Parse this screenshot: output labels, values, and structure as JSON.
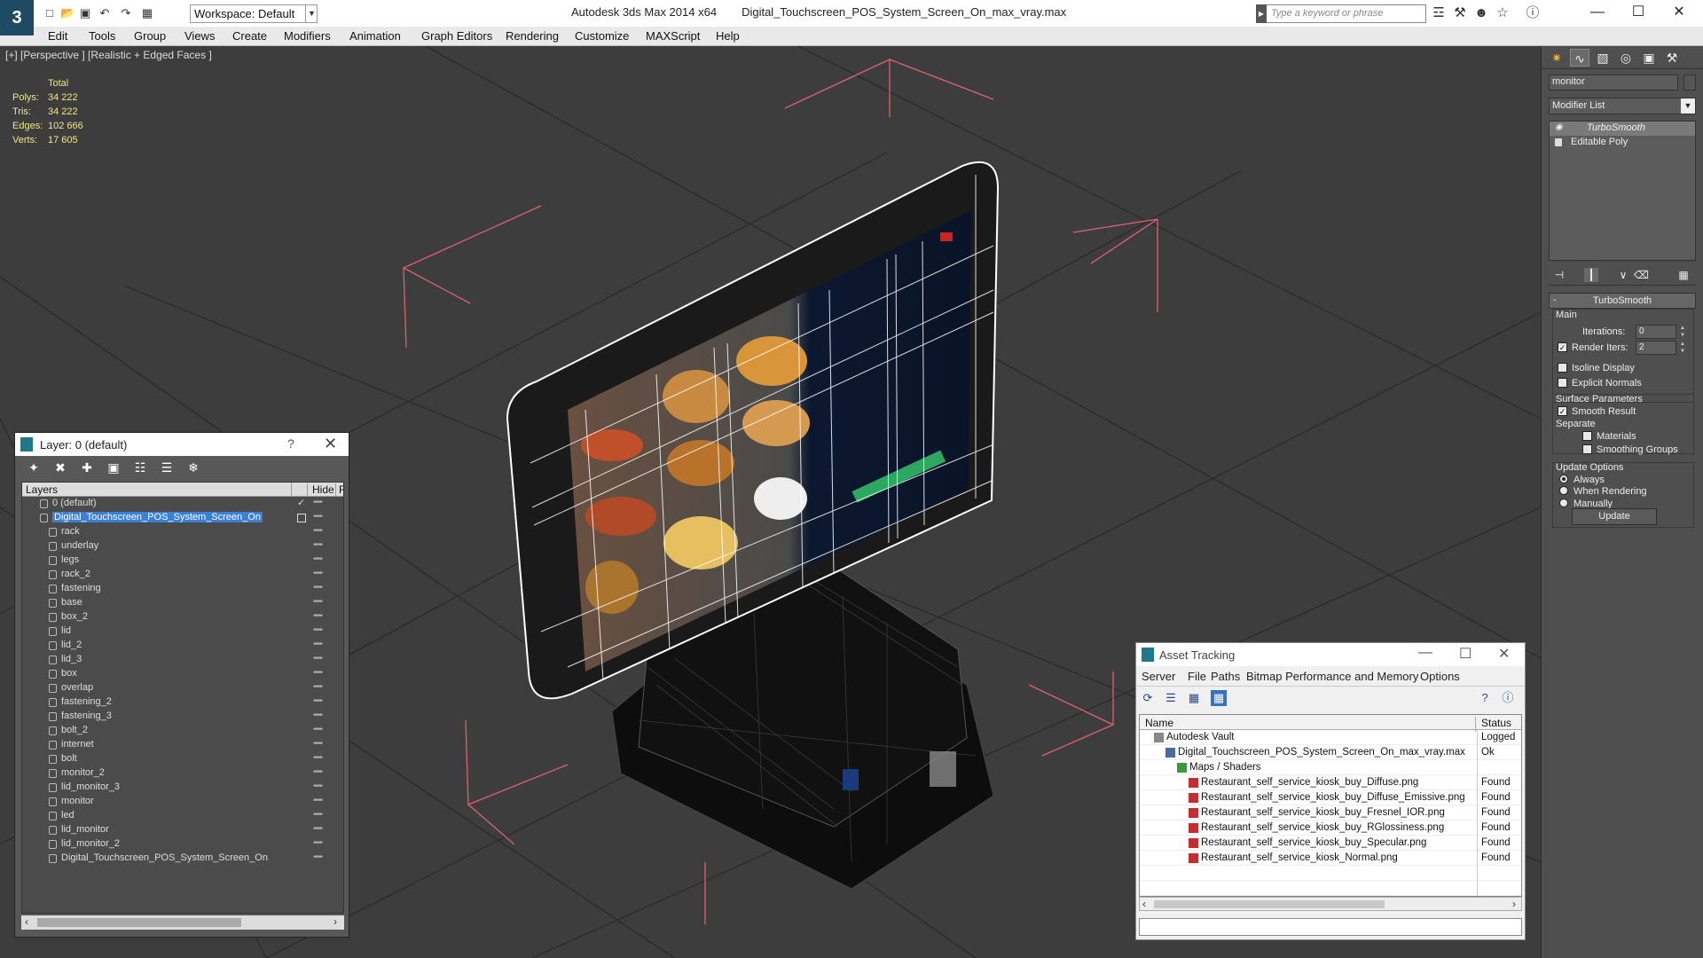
{
  "app": {
    "title": "Autodesk 3ds Max  2014 x64",
    "file": "Digital_Touchscreen_POS_System_Screen_On_max_vray.max",
    "workspace": "Workspace: Default",
    "search_placeholder": "Type a keyword or phrase"
  },
  "menu": [
    "Edit",
    "Tools",
    "Group",
    "Views",
    "Create",
    "Modifiers",
    "Animation",
    "Graph Editors",
    "Rendering",
    "Customize",
    "MAXScript",
    "Help"
  ],
  "viewport": {
    "label": "[+] [Perspective ] [Realistic + Edged Faces ]",
    "stats": {
      "header": "Total",
      "polys_label": "Polys:",
      "polys": "34 222",
      "tris_label": "Tris:",
      "tris": "34 222",
      "edges_label": "Edges:",
      "edges": "102 666",
      "verts_label": "Verts:",
      "verts": "17 605"
    }
  },
  "layer_panel": {
    "title": "Layer: 0 (default)",
    "help": "?",
    "col_layers": "Layers",
    "col_hide": "Hide",
    "col_f": "F",
    "default_layer": "0 (default)",
    "active_layer": "Digital_Touchscreen_POS_System_Screen_On",
    "objects": [
      "rack",
      "underlay",
      "legs",
      "rack_2",
      "fastening",
      "base",
      "box_2",
      "lid",
      "lid_2",
      "lid_3",
      "box",
      "overlap",
      "fastening_2",
      "fastening_3",
      "bolt_2",
      "internet",
      "bolt",
      "monitor_2",
      "lid_monitor_3",
      "monitor",
      "led",
      "lid_monitor",
      "lid_monitor_2",
      "Digital_Touchscreen_POS_System_Screen_On"
    ]
  },
  "asset_panel": {
    "title": "Asset Tracking",
    "menu": [
      "Server",
      "File",
      "Paths",
      "Bitmap Performance and Memory",
      "Options"
    ],
    "col_name": "Name",
    "col_status": "Status",
    "rows": [
      {
        "name": "Autodesk Vault",
        "status": "Logged",
        "indent": 0
      },
      {
        "name": "Digital_Touchscreen_POS_System_Screen_On_max_vray.max",
        "status": "Ok",
        "indent": 1
      },
      {
        "name": "Maps / Shaders",
        "status": "",
        "indent": 2
      },
      {
        "name": "Restaurant_self_service_kiosk_buy_Diffuse.png",
        "status": "Found",
        "indent": 3
      },
      {
        "name": "Restaurant_self_service_kiosk_buy_Diffuse_Emissive.png",
        "status": "Found",
        "indent": 3
      },
      {
        "name": "Restaurant_self_service_kiosk_buy_Fresnel_IOR.png",
        "status": "Found",
        "indent": 3
      },
      {
        "name": "Restaurant_self_service_kiosk_buy_RGlossiness.png",
        "status": "Found",
        "indent": 3
      },
      {
        "name": "Restaurant_self_service_kiosk_buy_Specular.png",
        "status": "Found",
        "indent": 3
      },
      {
        "name": "Restaurant_self_service_kiosk_Normal.png",
        "status": "Found",
        "indent": 3
      }
    ]
  },
  "command_panel": {
    "object_name": "monitor",
    "modifier_list": "Modifier List",
    "stack": [
      "TurboSmooth",
      "Editable Poly"
    ],
    "rollout_title": "TurboSmooth",
    "collapse": "-",
    "main_label": "Main",
    "iterations_label": "Iterations:",
    "iterations": "0",
    "render_iters_label": "Render Iters:",
    "render_iters": "2",
    "isoline_label": "Isoline Display",
    "explicit_normals_label": "Explicit Normals",
    "surface_params_label": "Surface Parameters",
    "smooth_result_label": "Smooth Result",
    "separate_label": "Separate",
    "materials_label": "Materials",
    "smoothing_groups_label": "Smoothing Groups",
    "update_options_label": "Update Options",
    "always_label": "Always",
    "when_rendering_label": "When Rendering",
    "manually_label": "Manually",
    "update_button": "Update",
    "render_iters_checked": true,
    "smooth_result_checked": true,
    "update_mode": "Always"
  },
  "colors": {
    "viewport_bg": "#3d3d3d",
    "stats_text": "#f0e68c",
    "selection_blue": "#3a7fd8",
    "bbox_pink": "#e06070"
  }
}
